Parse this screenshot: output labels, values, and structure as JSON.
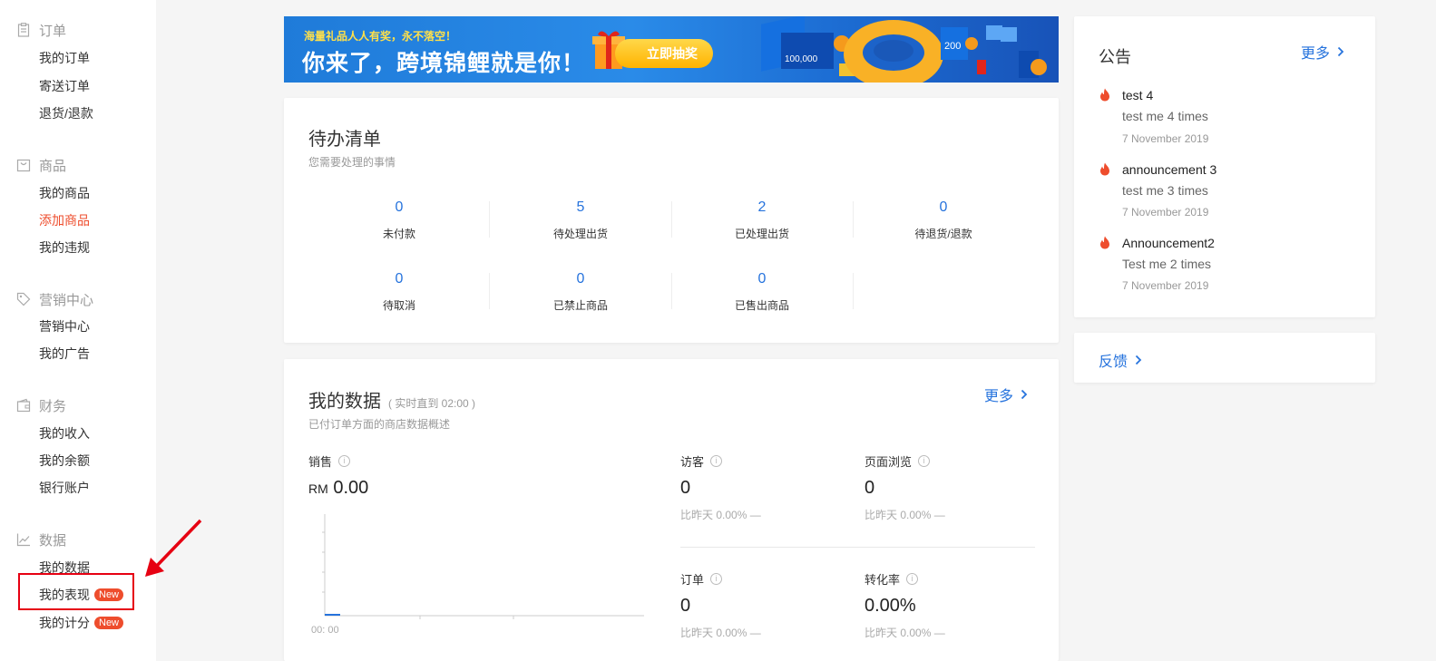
{
  "sidebar": {
    "sections": [
      {
        "title": "订单",
        "icon": "clipboard-icon",
        "items": [
          {
            "label": "我的订单"
          },
          {
            "label": "寄送订单"
          },
          {
            "label": "退货/退款"
          }
        ]
      },
      {
        "title": "商品",
        "icon": "bag-icon",
        "items": [
          {
            "label": "我的商品"
          },
          {
            "label": "添加商品"
          },
          {
            "label": "我的违规"
          }
        ]
      },
      {
        "title": "营销中心",
        "icon": "tag-icon",
        "items": [
          {
            "label": "营销中心"
          },
          {
            "label": "我的广告"
          }
        ]
      },
      {
        "title": "财务",
        "icon": "wallet-icon",
        "items": [
          {
            "label": "我的收入"
          },
          {
            "label": "我的余额"
          },
          {
            "label": "银行账户"
          }
        ]
      },
      {
        "title": "数据",
        "icon": "trend-chart-icon",
        "items": [
          {
            "label": "我的数据"
          },
          {
            "label": "我的表现",
            "badge": "New"
          },
          {
            "label": "我的计分",
            "badge": "New"
          }
        ]
      }
    ],
    "active_item": "添加商品"
  },
  "banner": {
    "small_text": "海量礼品人人有奖，永不落空！",
    "big_text": "你来了，跨境锦鲤就是你！",
    "button_label": "立即抽奖",
    "card_text_1": "100,000",
    "card_text_2": "200"
  },
  "todo": {
    "title": "待办清单",
    "subtitle": "您需要处理的事情",
    "items": [
      {
        "value": "0",
        "label": "未付款"
      },
      {
        "value": "5",
        "label": "待处理出货"
      },
      {
        "value": "2",
        "label": "已处理出货"
      },
      {
        "value": "0",
        "label": "待退货/退款"
      },
      {
        "value": "0",
        "label": "待取消"
      },
      {
        "value": "0",
        "label": "已禁止商品"
      },
      {
        "value": "0",
        "label": "已售出商品"
      }
    ]
  },
  "my_data": {
    "title": "我的数据",
    "realtime_note": "( 实时直到 02:00 )",
    "subtitle": "已付订单方面的商店数据概述",
    "more_label": "更多",
    "sales": {
      "label": "销售",
      "currency": "RM",
      "value": "0.00",
      "chart_x_label": "00: 00"
    },
    "metrics": [
      {
        "label": "访客",
        "value": "0",
        "compare": "比昨天 0.00% —"
      },
      {
        "label": "页面浏览",
        "value": "0",
        "compare": "比昨天 0.00% —"
      },
      {
        "label": "订单",
        "value": "0",
        "compare": "比昨天 0.00% —"
      },
      {
        "label": "转化率",
        "value": "0.00%",
        "compare": "比昨天 0.00% —"
      }
    ]
  },
  "announcements": {
    "title": "公告",
    "more_label": "更多",
    "items": [
      {
        "title": "test 4",
        "body": "test me 4 times",
        "date": "7 November 2019"
      },
      {
        "title": "announcement 3",
        "body": "test me 3 times",
        "date": "7 November 2019"
      },
      {
        "title": "Announcement2",
        "body": "Test me 2 times",
        "date": "7 November 2019"
      }
    ]
  },
  "feedback": {
    "label": "反馈"
  },
  "colors": {
    "accent_blue": "#2673dd",
    "brand_orange": "#ee4d2d",
    "highlight_red": "#e60012"
  }
}
